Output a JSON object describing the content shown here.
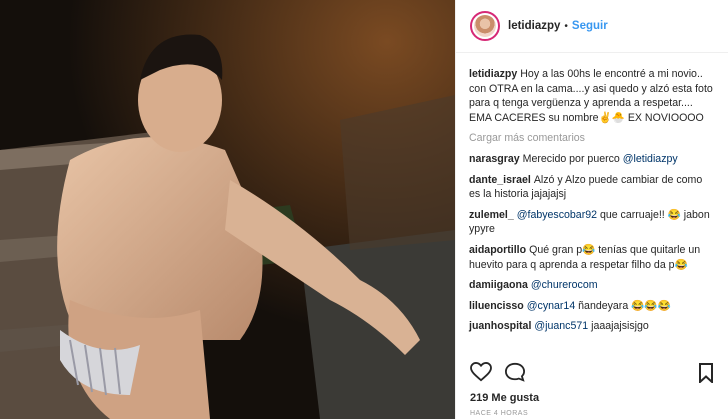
{
  "post": {
    "username": "letidiazpy",
    "follow_label": "Seguir",
    "separator": "•"
  },
  "caption": {
    "username": "letidiazpy",
    "text": "Hoy a las 00hs le encontré a mi novio.. con OTRA en la cama....y asi quedo y alzó esta foto para q tenga vergüenza y aprenda a respetar.... EMA CACERES su nombre✌️🐣 EX NOVIOOOO"
  },
  "load_more": "Cargar más comentarios",
  "comments": [
    {
      "user": "narasgray",
      "text": "Merecido por puerco ",
      "mention": "@letidiazpy",
      "after": ""
    },
    {
      "user": "dante_israel",
      "text": "Alzó y Alzo puede cambiar de como es la historia jajajajsj",
      "mention": "",
      "after": ""
    },
    {
      "user": "zulemel_",
      "text": "",
      "mention": "@fabyescobar92",
      "after": " que carruaje!! 😂 jabon ypyre"
    },
    {
      "user": "aidaportillo",
      "text": "Qué gran p😂 tenías que quitarle un huevito para q aprenda a respetar filho da p😂",
      "mention": "",
      "after": ""
    },
    {
      "user": "damiigaona",
      "text": "",
      "mention": "@churerocom",
      "after": ""
    },
    {
      "user": "liluencisso",
      "text": "",
      "mention": "@cynar14",
      "after": " ñandeyara 😂😂😂"
    },
    {
      "user": "juanhospital",
      "text": "",
      "mention": "@juanc571",
      "after": " jaaajajsisjgo"
    }
  ],
  "likes": "219 Me gusta",
  "time": "HACE 4 HORAS",
  "icons": [
    "heart-icon",
    "comment-icon",
    "bookmark-icon"
  ],
  "colors": {
    "link": "#3897f0",
    "mention": "#003569",
    "muted": "#999999"
  }
}
